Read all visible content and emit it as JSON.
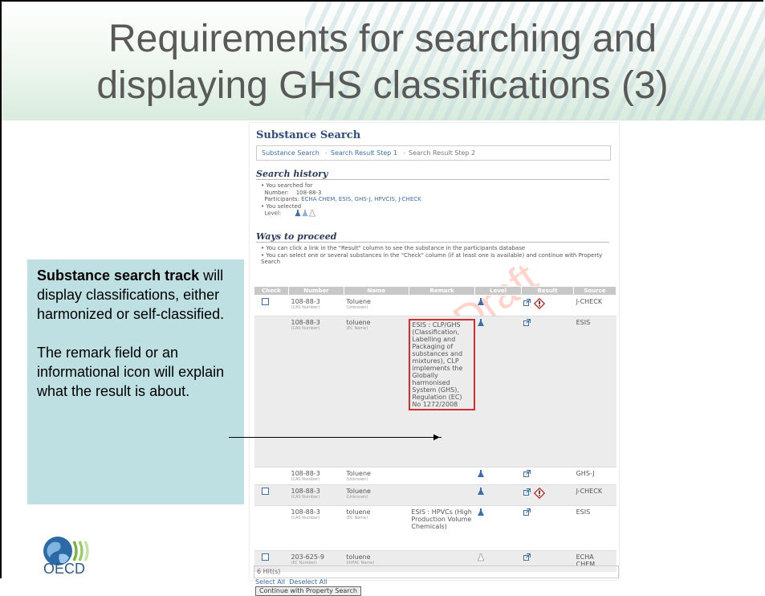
{
  "slide": {
    "title_line1": "Requirements for searching and",
    "title_line2": "displaying GHS classifications (3)"
  },
  "screen": {
    "title": "Substance Search",
    "breadcrumbs": [
      "Substance Search",
      "Search Result Step 1",
      "Search Result Step 2"
    ],
    "history_heading": "Search history",
    "history": {
      "searched_for": "You searched for",
      "number_label": "Number:",
      "number_value": "108-88-3",
      "participants_label": "Participants:",
      "participants_value": "ECHA CHEM, ESIS, GHS-J, HPVCIS, J-CHECK",
      "selected": "You selected",
      "level_label": "Level:"
    },
    "ways_heading": "Ways to proceed",
    "ways": [
      "You can click a link in the \"Result\" column to see the substance in the participants database",
      "You can select one or several substances in the \"Check\" column (if at least one is available) and continue with Property Search"
    ],
    "watermark": "Draft",
    "table": {
      "headers": [
        "Check",
        "Number",
        "Name",
        "Remark",
        "Level",
        "Result",
        "Source"
      ],
      "rows": [
        {
          "check": true,
          "number": "108-88-3",
          "number_type": "(CAS Number)",
          "name": "Toluene",
          "name_type": "(Unknown)",
          "remark": "",
          "source": "J-CHECK",
          "ghs": true
        },
        {
          "check": false,
          "number": "108-88-3",
          "number_type": "(CAS Number)",
          "name": "toluene",
          "name_type": "(EC Name)",
          "remark": "ESIS : CLP/GHS (Classification, Labelling and Packaging of substances and mixtures), CLP implements the Globally harmonised System (GHS), Regulation (EC) No 1272/2008",
          "source": "ESIS",
          "ghs": false
        },
        {
          "check": false,
          "number": "108-88-3",
          "number_type": "(CAS Number)",
          "name": "Toluene",
          "name_type": "(Unknown)",
          "remark": "",
          "source": "GHS-J",
          "ghs": false
        },
        {
          "check": true,
          "number": "108-88-3",
          "number_type": "(CAS Number)",
          "name": "Toluene",
          "name_type": "(Unknown)",
          "remark": "",
          "source": "J-CHECK",
          "ghs": true
        },
        {
          "check": false,
          "number": "108-88-3",
          "number_type": "(CAS Number)",
          "name": "toluene",
          "name_type": "(EC Name)",
          "remark": "ESIS : HPVCs (High Production Volume Chemicals)",
          "source": "ESIS",
          "ghs": false
        },
        {
          "check": true,
          "number": "203-625-9",
          "number_type": "(EC Number)",
          "name": "toluene",
          "name_type": "(IUPAC Name)",
          "remark": "",
          "source": "ECHA CHEM",
          "ghs": false
        }
      ]
    },
    "hits": "6 Hit(s)",
    "select_all": "Select All",
    "deselect_all": "Deselect All",
    "continue_button": "Continue with Property Search"
  },
  "callout": {
    "bold": "Substance search track",
    "p1_rest": " will display classifications, either harmonized or self-classified.",
    "p2": "The remark field or an informational icon will explain what the result is about."
  },
  "logo": {
    "text": "OECD"
  },
  "colors": {
    "callout_bg": "#bfe0e2",
    "remark_border": "#d23030",
    "link": "#3b6ea8",
    "title": "#595959"
  }
}
